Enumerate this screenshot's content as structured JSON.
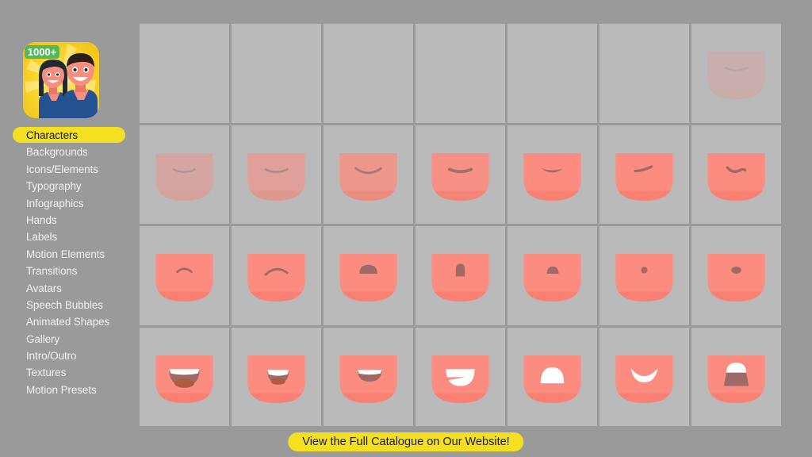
{
  "theme": {
    "background": "#9a9a9a",
    "cell_background": "#bababa",
    "accent_yellow": "#f4df20",
    "skin": "#fc8c80",
    "mouth_dark": "#9e6a66",
    "teeth_white": "#ffffff",
    "tongue": "#b05a3f",
    "menu_text": "#f2f2f2",
    "selected_text": "#1a1a1a"
  },
  "sidebar": {
    "app_icon": {
      "name": "characters-app-icon",
      "badge": "1000+",
      "badge_color": "#5cb85c",
      "background": "#f7d32e"
    },
    "items": [
      {
        "label": "Characters",
        "selected": true
      },
      {
        "label": "Backgrounds",
        "selected": false
      },
      {
        "label": "Icons/Elements",
        "selected": false
      },
      {
        "label": "Typography",
        "selected": false
      },
      {
        "label": "Infographics",
        "selected": false
      },
      {
        "label": "Hands",
        "selected": false
      },
      {
        "label": "Labels",
        "selected": false
      },
      {
        "label": "Motion Elements",
        "selected": false
      },
      {
        "label": "Transitions",
        "selected": false
      },
      {
        "label": "Avatars",
        "selected": false
      },
      {
        "label": "Speech Bubbles",
        "selected": false
      },
      {
        "label": "Animated Shapes",
        "selected": false
      },
      {
        "label": "Gallery",
        "selected": false
      },
      {
        "label": "Intro/Outro",
        "selected": false
      },
      {
        "label": "Textures",
        "selected": false
      },
      {
        "label": "Motion Presets",
        "selected": false
      }
    ]
  },
  "grid": {
    "columns": 7,
    "rows": 4,
    "cells": [
      {
        "name": "mouth-preview-r1c1",
        "style": "empty",
        "opacity": 0
      },
      {
        "name": "mouth-preview-r1c2",
        "style": "empty",
        "opacity": 0
      },
      {
        "name": "mouth-preview-r1c3",
        "style": "empty",
        "opacity": 0
      },
      {
        "name": "mouth-preview-r1c4",
        "style": "empty",
        "opacity": 0
      },
      {
        "name": "mouth-preview-r1c5",
        "style": "empty",
        "opacity": 0
      },
      {
        "name": "mouth-preview-r1c6",
        "style": "empty",
        "opacity": 0
      },
      {
        "name": "mouth-preview-r1c7",
        "style": "line-flat",
        "opacity": 0.22
      },
      {
        "name": "mouth-preview-r2c1",
        "style": "line-flat",
        "opacity": 0.42
      },
      {
        "name": "mouth-preview-r2c2",
        "style": "line-flat",
        "opacity": 0.58
      },
      {
        "name": "mouth-preview-r2c3",
        "style": "line-smile",
        "opacity": 0.78
      },
      {
        "name": "mouth-preview-r2c4",
        "style": "line-thick",
        "opacity": 0.92
      },
      {
        "name": "mouth-preview-r2c5",
        "style": "lip-thick",
        "opacity": 1
      },
      {
        "name": "mouth-preview-r2c6",
        "style": "line-slant",
        "opacity": 1
      },
      {
        "name": "mouth-preview-r2c7",
        "style": "line-wave",
        "opacity": 1
      },
      {
        "name": "mouth-preview-r3c1",
        "style": "arc-small",
        "opacity": 1
      },
      {
        "name": "mouth-preview-r3c2",
        "style": "arc-wide",
        "opacity": 1
      },
      {
        "name": "mouth-preview-r3c3",
        "style": "dome-wide",
        "opacity": 1
      },
      {
        "name": "mouth-preview-r3c4",
        "style": "oval-tall",
        "opacity": 1
      },
      {
        "name": "mouth-preview-r3c5",
        "style": "dome-small",
        "opacity": 1
      },
      {
        "name": "mouth-preview-r3c6",
        "style": "dot-round",
        "opacity": 1
      },
      {
        "name": "mouth-preview-r3c7",
        "style": "dot-oval",
        "opacity": 1
      },
      {
        "name": "mouth-preview-r4c1",
        "style": "open-teeth-large",
        "opacity": 1
      },
      {
        "name": "mouth-preview-r4c2",
        "style": "open-teeth-small",
        "opacity": 1
      },
      {
        "name": "mouth-preview-r4c3",
        "style": "open-teeth-thin",
        "opacity": 1
      },
      {
        "name": "mouth-preview-r4c4",
        "style": "teeth-bowl",
        "opacity": 1
      },
      {
        "name": "mouth-preview-r4c5",
        "style": "teeth-dome",
        "opacity": 1
      },
      {
        "name": "mouth-preview-r4c6",
        "style": "teeth-arch",
        "opacity": 1
      },
      {
        "name": "mouth-preview-r4c7",
        "style": "teeth-open-dark",
        "opacity": 1
      }
    ]
  },
  "banner": {
    "label": "View the Full Catalogue on Our Website!"
  }
}
